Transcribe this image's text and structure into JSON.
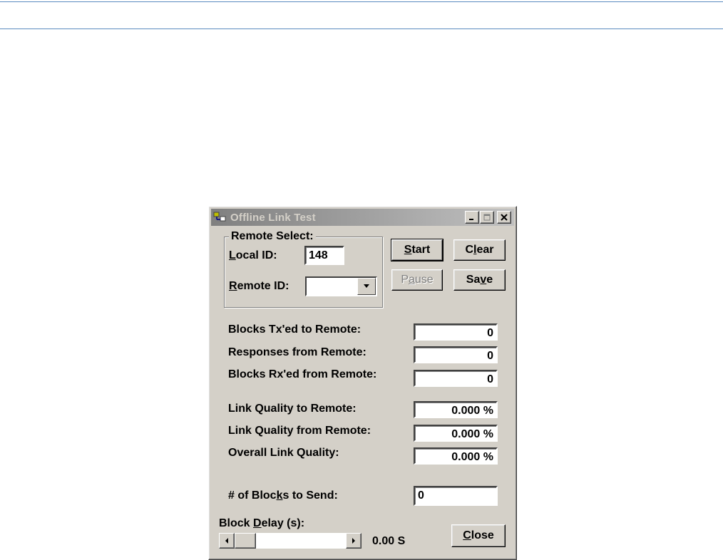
{
  "window": {
    "title": "Offline Link Test"
  },
  "remote_select": {
    "group_label": "Remote Select:",
    "local_id_label_accel": "L",
    "local_id_label_rest": "ocal ID:",
    "local_id_value": "148",
    "remote_id_label_accel": "R",
    "remote_id_label_rest": "emote ID:",
    "remote_id_value": ""
  },
  "buttons": {
    "start_accel": "S",
    "start_rest": "tart",
    "clear_pre": "C",
    "clear_accel": "l",
    "clear_rest": "ear",
    "pause_pre": "P",
    "pause_accel": "a",
    "pause_rest": "use",
    "save_pre": "Sa",
    "save_accel": "v",
    "save_rest": "e",
    "close_accel": "C",
    "close_rest": "lose"
  },
  "stats": [
    {
      "label": "Blocks Tx'ed to Remote:",
      "value": "0"
    },
    {
      "label": "Responses from Remote:",
      "value": "0"
    },
    {
      "label": "Blocks Rx'ed from Remote:",
      "value": "0"
    }
  ],
  "quality": [
    {
      "label": "Link Quality to Remote:",
      "value": "0.000 %"
    },
    {
      "label": "Link Quality from Remote:",
      "value": "0.000 %"
    },
    {
      "label": "Overall Link Quality:",
      "value": "0.000 %"
    }
  ],
  "blocks_to_send": {
    "label_pre": "# of Bloc",
    "label_accel": "k",
    "label_rest": "s to Send:",
    "value": "0"
  },
  "block_delay": {
    "label_pre": "Block ",
    "label_accel": "D",
    "label_rest": "elay (s):",
    "readout": "0.00 S"
  },
  "colors": {
    "dialog_face": "#d4d0c8",
    "page_rule": "#5b8bc0"
  }
}
